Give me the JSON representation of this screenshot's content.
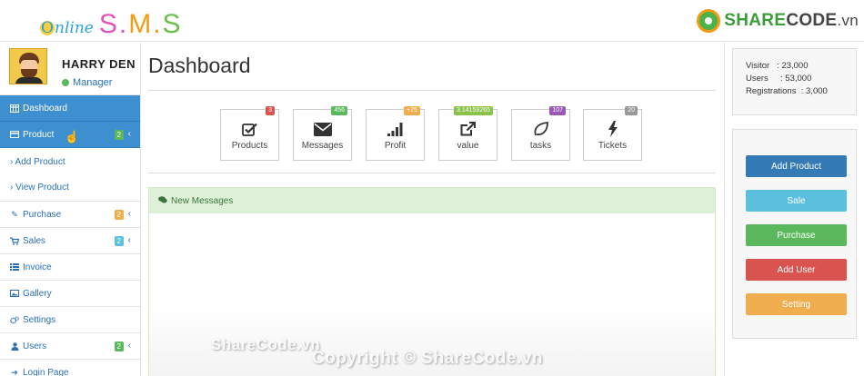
{
  "header": {
    "logo": {
      "online": "nline",
      "online_o": "O",
      "s1": "S.",
      "m": "M.",
      "s2": "S"
    },
    "brand": {
      "share": "SHARE",
      "code": "CODE",
      "vn": ".vn"
    }
  },
  "profile": {
    "name": "HARRY DEN",
    "role": "Manager"
  },
  "sidebar": {
    "items": [
      {
        "label": "Dashboard",
        "icon": "table-icon"
      },
      {
        "label": "Product",
        "icon": "credit-card-icon",
        "badge": "2",
        "badge_color": "#5cb85c",
        "chev": "‹"
      },
      {
        "label": "Purchase",
        "icon": "pencil-icon",
        "badge": "2",
        "badge_color": "#f0ad4e",
        "chev": "‹"
      },
      {
        "label": "Sales",
        "icon": "cart-icon",
        "badge": "2",
        "badge_color": "#5bc0de",
        "chev": "‹"
      },
      {
        "label": "Invoice",
        "icon": "list-icon"
      },
      {
        "label": "Gallery",
        "icon": "image-icon"
      },
      {
        "label": "Settings",
        "icon": "cogs-icon"
      },
      {
        "label": "Users",
        "icon": "user-icon",
        "badge": "2",
        "badge_color": "#5cb85c",
        "chev": "‹"
      },
      {
        "label": "Login Page",
        "icon": "sign-in-icon"
      }
    ],
    "sub_items": [
      {
        "label": "› Add Product"
      },
      {
        "label": "› View Product"
      }
    ]
  },
  "main": {
    "title": "Dashboard",
    "stats": [
      {
        "label": "Products",
        "badge": "3",
        "badge_color": "#d9534f",
        "icon": "checkbox-icon"
      },
      {
        "label": "Messages",
        "badge": "456",
        "badge_color": "#5cb85c",
        "icon": "envelope-icon"
      },
      {
        "label": "Profit",
        "badge": "+25",
        "badge_color": "#f0ad4e",
        "icon": "signal-bars-icon"
      },
      {
        "label": "value",
        "badge": "3.14159265",
        "badge_color": "#8bc34a",
        "icon": "external-link-icon"
      },
      {
        "label": "tasks",
        "badge": "107",
        "badge_color": "#9b59b6",
        "icon": "leaf-icon"
      },
      {
        "label": "Tickets",
        "badge": "20",
        "badge_color": "#999999",
        "icon": "bolt-icon"
      }
    ],
    "messages_panel": {
      "title": "New Messages"
    }
  },
  "right": {
    "stats": [
      {
        "label": "Visitor",
        "value": "23,000"
      },
      {
        "label": "Users",
        "value": "53,000"
      },
      {
        "label": "Registrations",
        "value": "3,000"
      }
    ],
    "actions": [
      {
        "label": "Add Product",
        "color": "#337ab7"
      },
      {
        "label": "Sale",
        "color": "#5bc0de"
      },
      {
        "label": "Purchase",
        "color": "#5cb85c"
      },
      {
        "label": "Add User",
        "color": "#d9534f"
      },
      {
        "label": "Setting",
        "color": "#f0ad4e"
      }
    ]
  },
  "watermark": {
    "line1": "ShareCode.vn",
    "line2": "Copyright © ShareCode.vn"
  }
}
